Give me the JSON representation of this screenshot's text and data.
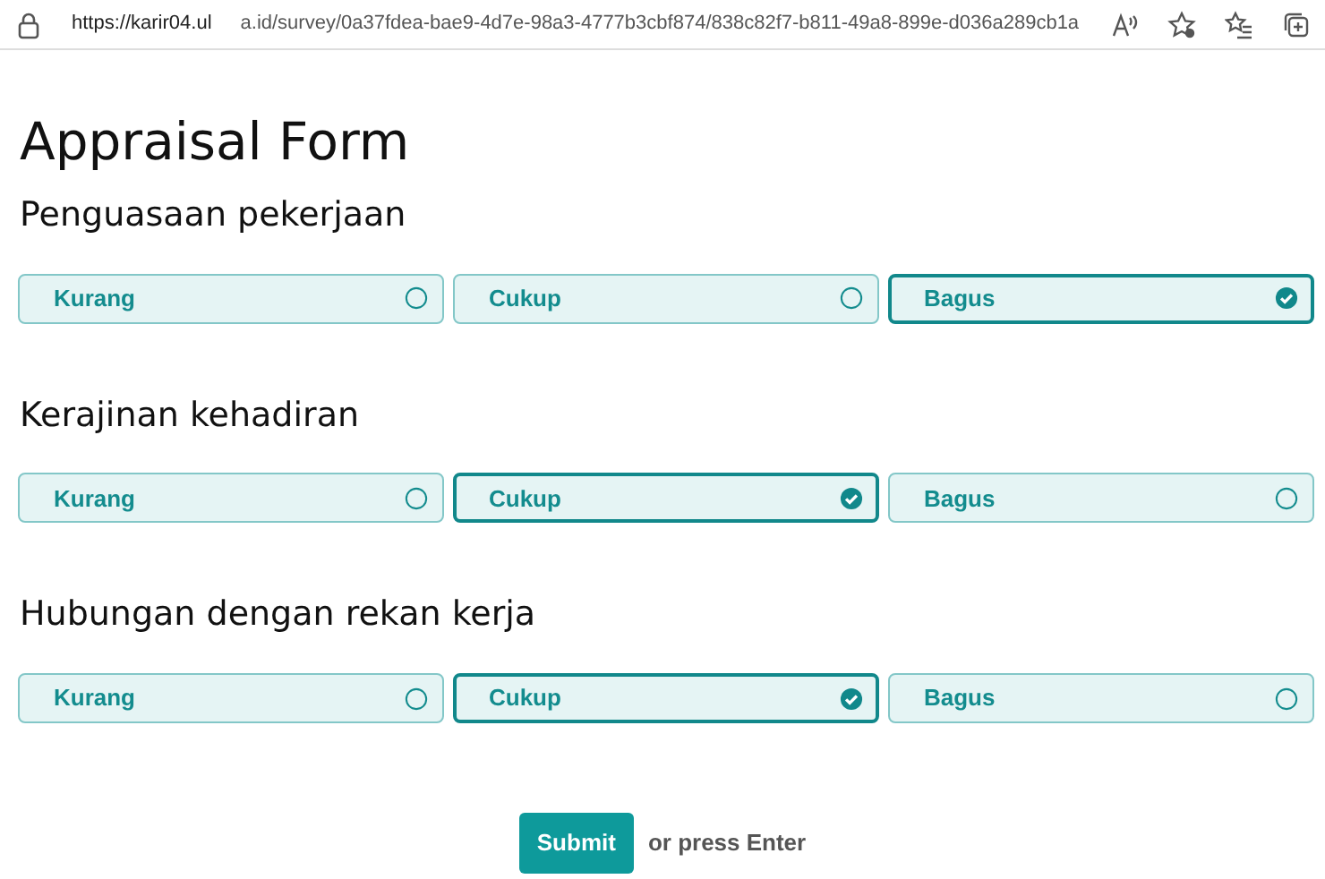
{
  "browser": {
    "url_start": "https://karir04.ul",
    "url_end": "a.id/survey/0a37fdea-bae9-4d7e-98a3-4777b3cbf874/838c82f7-b811-49a8-899e-d036a289cb1a"
  },
  "title": "Appraisal Form",
  "questions": [
    {
      "label": "Penguasaan pekerjaan",
      "options": [
        {
          "label": "Kurang",
          "selected": false
        },
        {
          "label": "Cukup",
          "selected": false
        },
        {
          "label": "Bagus",
          "selected": true
        }
      ]
    },
    {
      "label": "Kerajinan kehadiran",
      "options": [
        {
          "label": "Kurang",
          "selected": false
        },
        {
          "label": "Cukup",
          "selected": true
        },
        {
          "label": "Bagus",
          "selected": false
        }
      ]
    },
    {
      "label": "Hubungan dengan rekan kerja",
      "options": [
        {
          "label": "Kurang",
          "selected": false
        },
        {
          "label": "Cukup",
          "selected": true
        },
        {
          "label": "Bagus",
          "selected": false
        }
      ]
    }
  ],
  "submit": {
    "label": "Submit",
    "hint": "or press Enter"
  }
}
